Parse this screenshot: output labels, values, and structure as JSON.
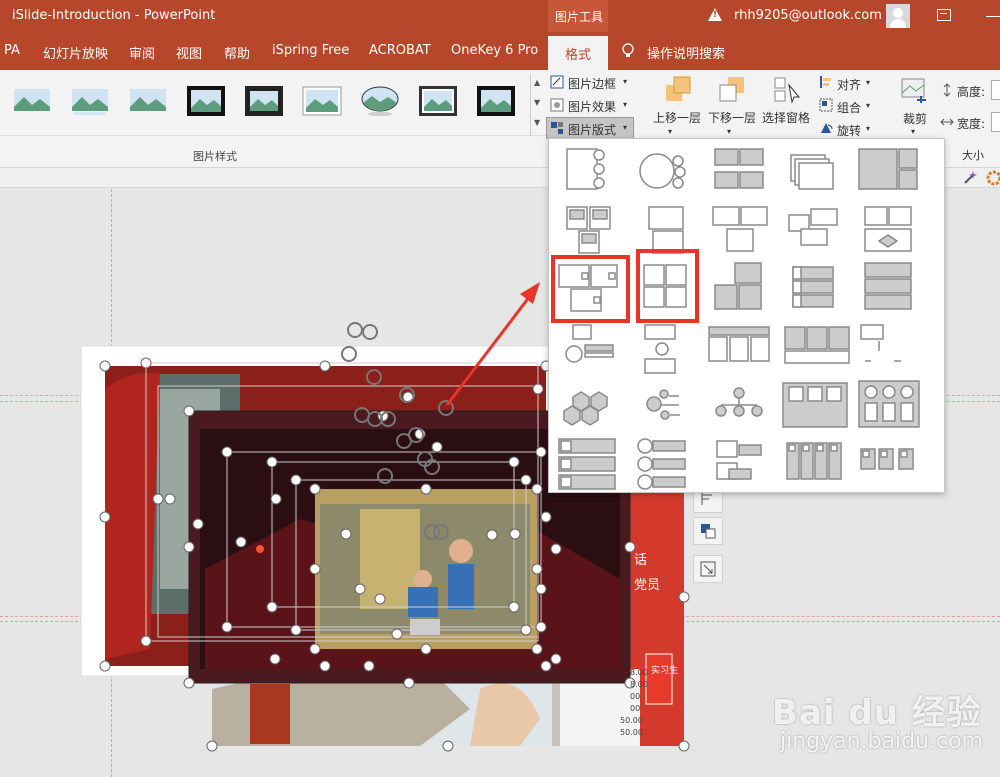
{
  "window": {
    "title": "iSlide-Introduction  -  PowerPoint",
    "contextual_group": "图片工具",
    "account": "rhh9205@outlook.com"
  },
  "tabs": [
    {
      "label": "PA"
    },
    {
      "label": "幻灯片放映"
    },
    {
      "label": "审阅"
    },
    {
      "label": "视图"
    },
    {
      "label": "帮助"
    },
    {
      "label": "iSpring Free"
    },
    {
      "label": "ACROBAT"
    },
    {
      "label": "OneKey 6 Pro"
    },
    {
      "label": "格式"
    }
  ],
  "search_tip": "操作说明搜索",
  "ribbon": {
    "picture_styles_group": "图片样式",
    "picture_border": "图片边框",
    "picture_effects": "图片效果",
    "picture_layout": "图片版式",
    "bring_forward": "上移一层",
    "send_backward": "下移一层",
    "selection_pane": "选择窗格",
    "align": "对齐",
    "group": "组合",
    "rotate": "旋转",
    "crop": "裁剪",
    "height_label": "高度:",
    "width_label": "宽度:",
    "size_group": "大小"
  },
  "colors": {
    "title_bar": "#b7472a",
    "highlight": "#e8342b",
    "layout_gray": "#bfbfbf"
  },
  "slide": {
    "sign_text_1": "话",
    "sign_text_2": "党员",
    "sign_text_3": "实习生",
    "table_values": [
      "8.00",
      "8.00",
      "00",
      "00",
      "50.00",
      "50.00"
    ]
  },
  "watermark": {
    "logo": "Bai  du 经验",
    "url": "jingyan.baidu.com"
  }
}
